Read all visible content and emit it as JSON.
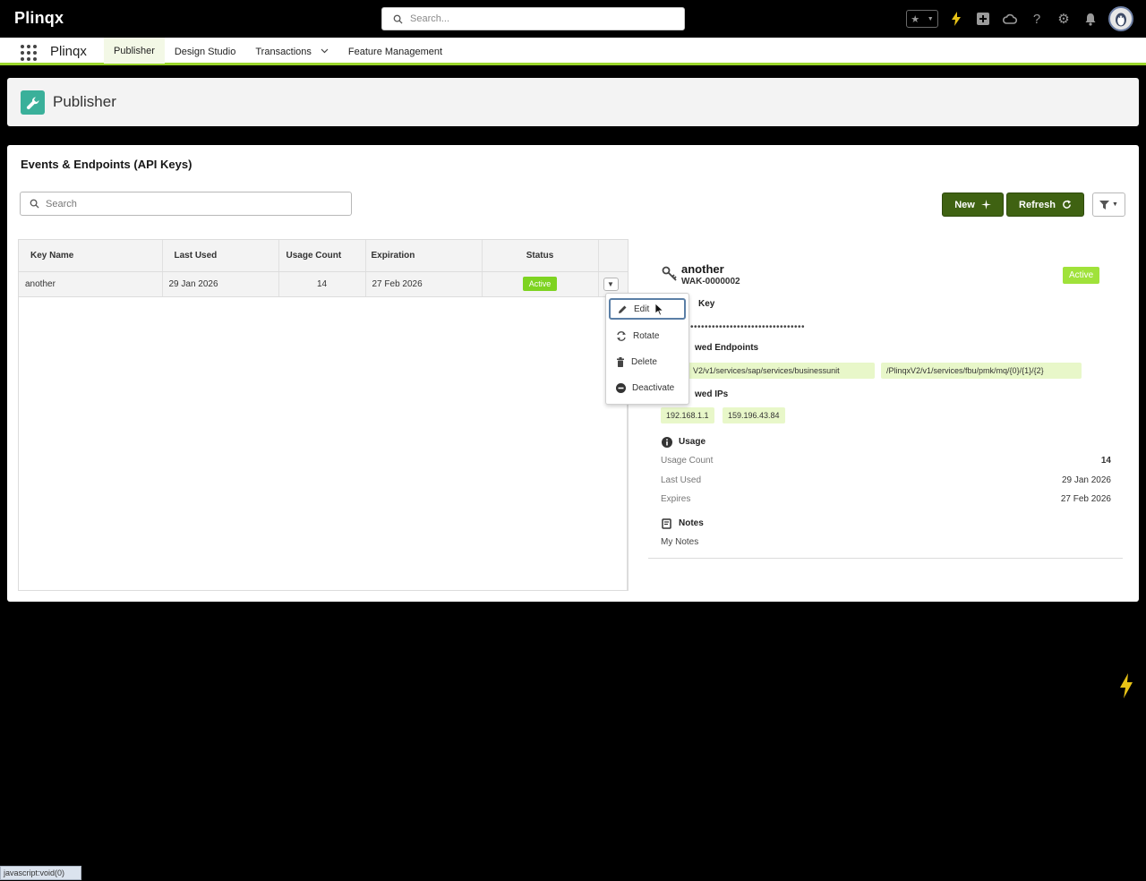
{
  "topbar": {
    "logo": "Plinqx",
    "search_placeholder": "Search..."
  },
  "nav": {
    "app_name": "Plinqx",
    "items": [
      {
        "label": "Publisher",
        "active": true
      },
      {
        "label": "Design Studio"
      },
      {
        "label": "Transactions",
        "has_menu": true
      },
      {
        "label": "Feature Management"
      }
    ]
  },
  "page": {
    "title": "Publisher"
  },
  "card": {
    "title": "Events & Endpoints (API Keys)",
    "search_placeholder": "Search",
    "new_label": "New",
    "refresh_label": "Refresh"
  },
  "table": {
    "headers": [
      "Key Name",
      "Last Used",
      "Usage Count",
      "Expiration",
      "Status"
    ],
    "rows": [
      {
        "key_name": "another",
        "last_used": "29 Jan 2026",
        "usage_count": "14",
        "expiration": "27 Feb 2026",
        "status": "Active"
      }
    ]
  },
  "row_menu": {
    "items": [
      "Edit",
      "Rotate",
      "Delete",
      "Deactivate"
    ]
  },
  "detail": {
    "name": "another",
    "id": "WAK-0000002",
    "status": "Active",
    "key_label": "Key",
    "key_mask": "••••••••••••••••••••••••••••••••",
    "endpoints_label": "wed Endpoints",
    "endpoints": [
      "V2/v1/services/sap/services/businessunit",
      "/PlinqxV2/v1/services/fbu/pmk/mq/{0}/{1}/{2}"
    ],
    "ips_label": "wed IPs",
    "ips": [
      "192.168.1.1",
      "159.196.43.84"
    ],
    "usage_label": "Usage",
    "usage_count_label": "Usage Count",
    "usage_count": "14",
    "last_used_label": "Last Used",
    "last_used": "29 Jan 2026",
    "expires_label": "Expires",
    "expires": "27 Feb 2026",
    "notes_label": "Notes",
    "notes": "My Notes"
  },
  "statusbar": {
    "text": "javascript:void(0)"
  },
  "colors": {
    "brand_green": "#3f6212",
    "accent_lime": "#9ad62a",
    "active_badge": "#7ed321",
    "chip_bg": "#e8f7c9",
    "header_icon": "#3ab09a"
  },
  "icons": [
    "search-icon",
    "favorites-star-icon",
    "lightning-icon",
    "add-icon",
    "setup-cloud-icon",
    "help-icon",
    "gear-icon",
    "bell-icon",
    "avatar",
    "app-launcher-icon",
    "wrench-icon",
    "add-sparkle-icon",
    "refresh-icon",
    "filter-icon",
    "chevron-down-icon",
    "key-icon",
    "edit-icon",
    "rotate-icon",
    "delete-icon",
    "deactivate-icon",
    "info-icon",
    "notes-icon",
    "cursor-icon"
  ]
}
